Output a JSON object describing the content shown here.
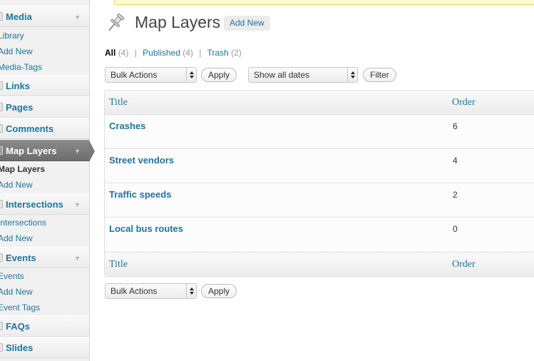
{
  "sidebar": {
    "media": {
      "label": "Media",
      "items": [
        "Library",
        "Add New",
        "Media-Tags"
      ]
    },
    "links": {
      "label": "Links"
    },
    "pages": {
      "label": "Pages"
    },
    "comments": {
      "label": "Comments"
    },
    "map_layers": {
      "label": "Map Layers",
      "items": [
        "Map Layers",
        "Add New"
      ]
    },
    "intersections": {
      "label": "Intersections",
      "items": [
        "Intersections",
        "Add New"
      ]
    },
    "events": {
      "label": "Events",
      "items": [
        "Events",
        "Add New",
        "Event Tags"
      ]
    },
    "faqs": {
      "label": "FAQs"
    },
    "slides": {
      "label": "Slides"
    }
  },
  "header": {
    "title": "Map Layers",
    "add_new": "Add New"
  },
  "filters": {
    "all": {
      "label": "All",
      "count": "(4)"
    },
    "published": {
      "label": "Published",
      "count": "(4)"
    },
    "trash": {
      "label": "Trash",
      "count": "(2)"
    },
    "separator": "|"
  },
  "toolbar": {
    "bulk_actions": "Bulk Actions",
    "apply": "Apply",
    "dates": "Show all dates",
    "filter": "Filter"
  },
  "table": {
    "columns": [
      "Title",
      "Order"
    ],
    "rows": [
      {
        "title": "Crashes",
        "order": "6"
      },
      {
        "title": "Street vendors",
        "order": "4"
      },
      {
        "title": "Traffic speeds",
        "order": "2"
      },
      {
        "title": "Local bus routes",
        "order": "0"
      }
    ]
  },
  "colors": {
    "link": "#21759b",
    "active_menu": "#7a7a7a"
  },
  "icons": {
    "header": "pushpin-icon"
  }
}
